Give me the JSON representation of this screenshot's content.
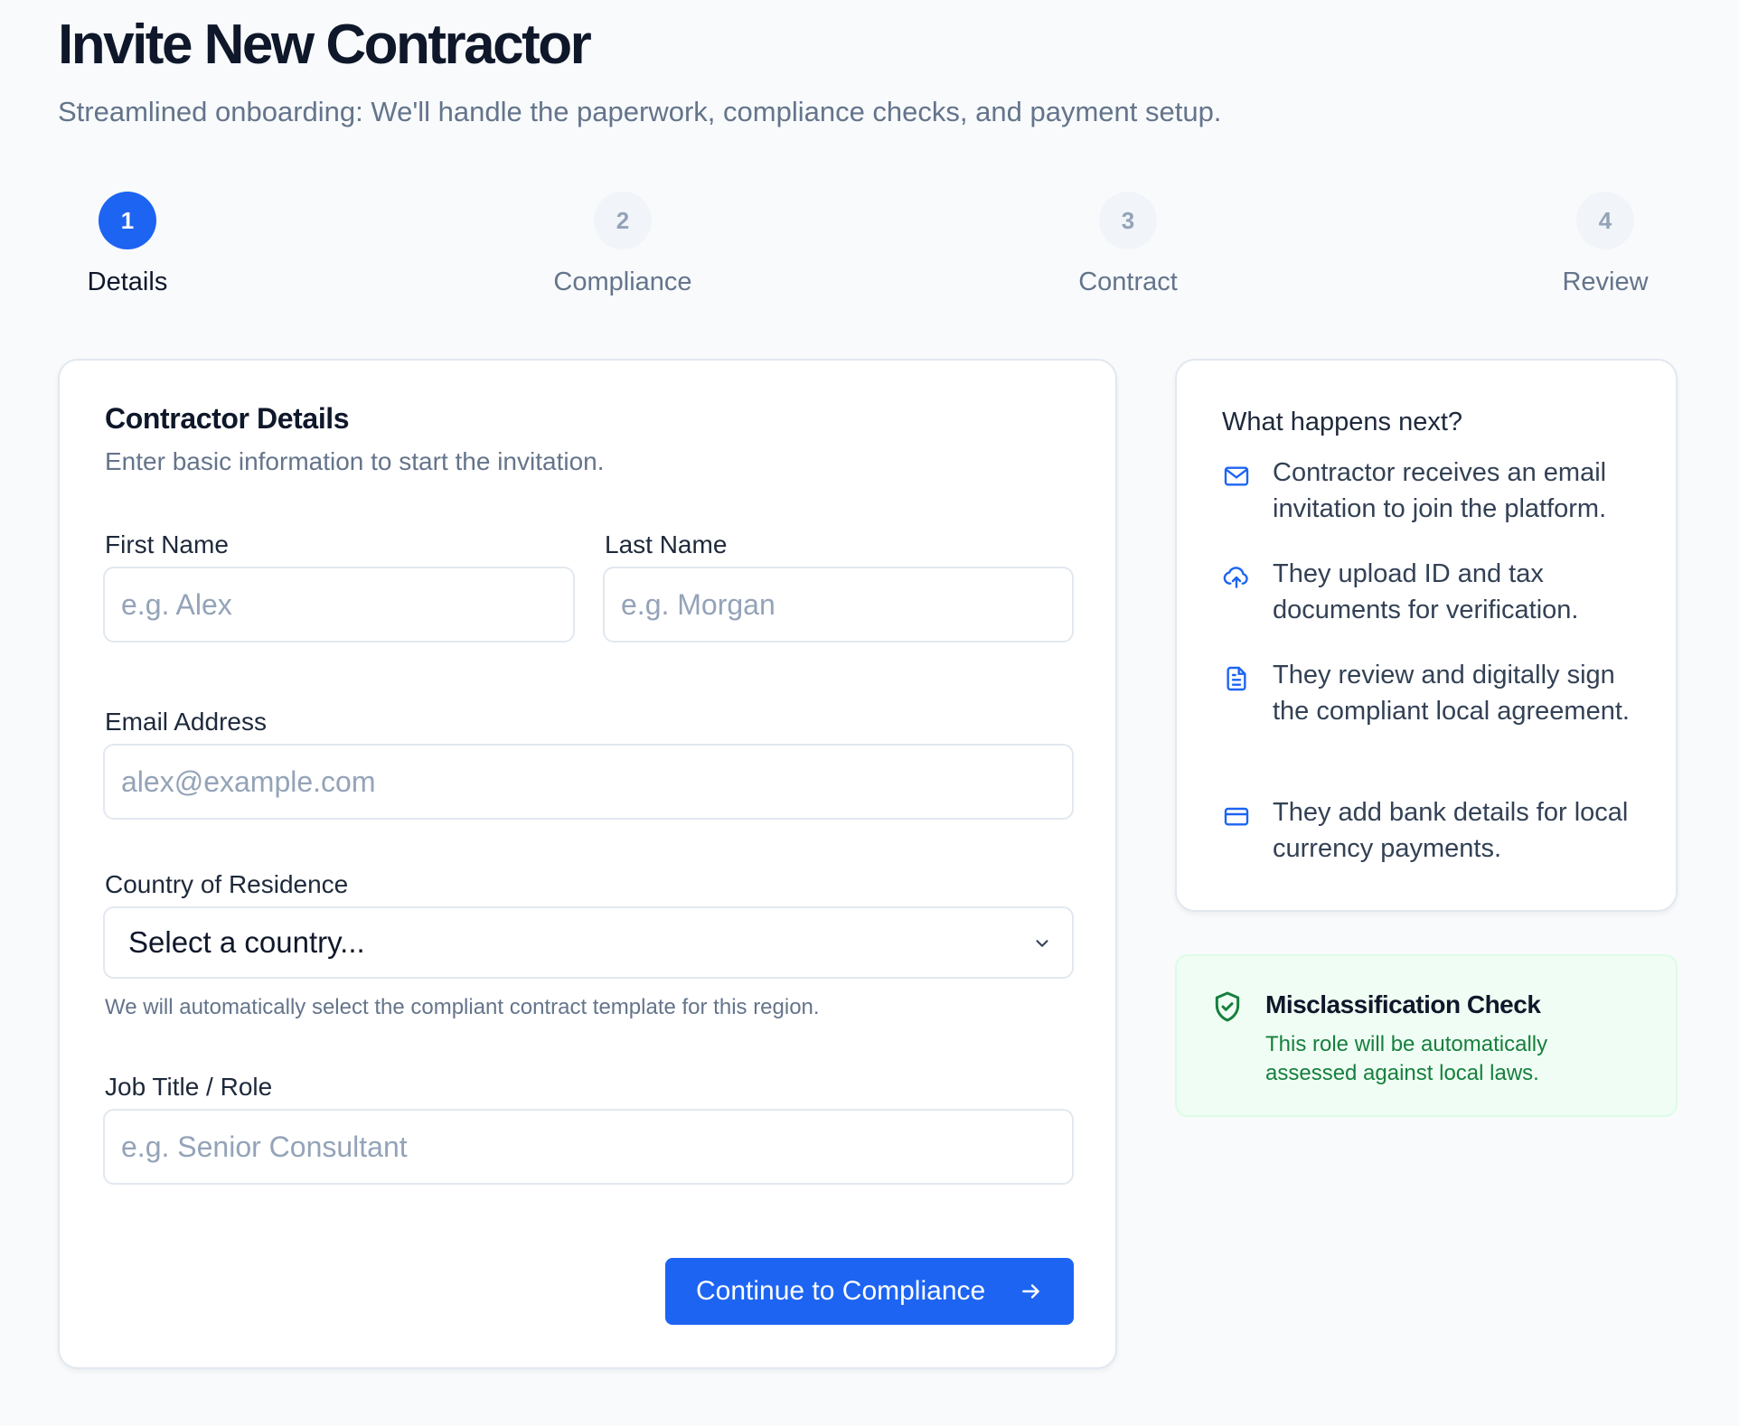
{
  "header": {
    "title": "Invite New Contractor",
    "subtitle": "Streamlined onboarding: We'll handle the paperwork, compliance checks, and payment setup."
  },
  "stepper": {
    "current_step": 1,
    "steps": [
      {
        "number": "1",
        "label": "Details",
        "state": "active"
      },
      {
        "number": "2",
        "label": "Compliance",
        "state": "pending"
      },
      {
        "number": "3",
        "label": "Contract",
        "state": "pending"
      },
      {
        "number": "4",
        "label": "Review",
        "state": "pending"
      }
    ]
  },
  "form": {
    "title": "Contractor Details",
    "description": "Enter basic information to start the invitation.",
    "first_name": {
      "label": "First Name",
      "value": "",
      "placeholder": "e.g. Alex"
    },
    "last_name": {
      "label": "Last Name",
      "value": "",
      "placeholder": "e.g. Morgan"
    },
    "email": {
      "label": "Email Address",
      "value": "",
      "placeholder": "alex@example.com"
    },
    "country": {
      "label": "Country of Residence",
      "selected": "Select a country...",
      "helper": "We will automatically select the compliant contract template for this region."
    },
    "job_title": {
      "label": "Job Title / Role",
      "value": "",
      "placeholder": "e.g. Senior Consultant"
    },
    "continue_label": "Continue to Compliance"
  },
  "next_steps": {
    "title": "What happens next?",
    "items": [
      {
        "icon": "mail-icon",
        "text": "Contractor receives an email invitation to join the platform."
      },
      {
        "icon": "cloud-upload-icon",
        "text": "They upload ID and tax documents for verification."
      },
      {
        "icon": "document-icon",
        "text": "They review and digitally sign the compliant local agreement."
      },
      {
        "icon": "credit-card-icon",
        "text": "They add bank details for local currency payments."
      }
    ]
  },
  "alert": {
    "icon": "shield-check-icon",
    "title": "Misclassification Check",
    "text": "This role will be automatically assessed against local laws."
  },
  "colors": {
    "primary": "#1d64f2",
    "success_bg": "#f0fdf4",
    "success_text": "#15803d",
    "muted": "#64748b"
  }
}
